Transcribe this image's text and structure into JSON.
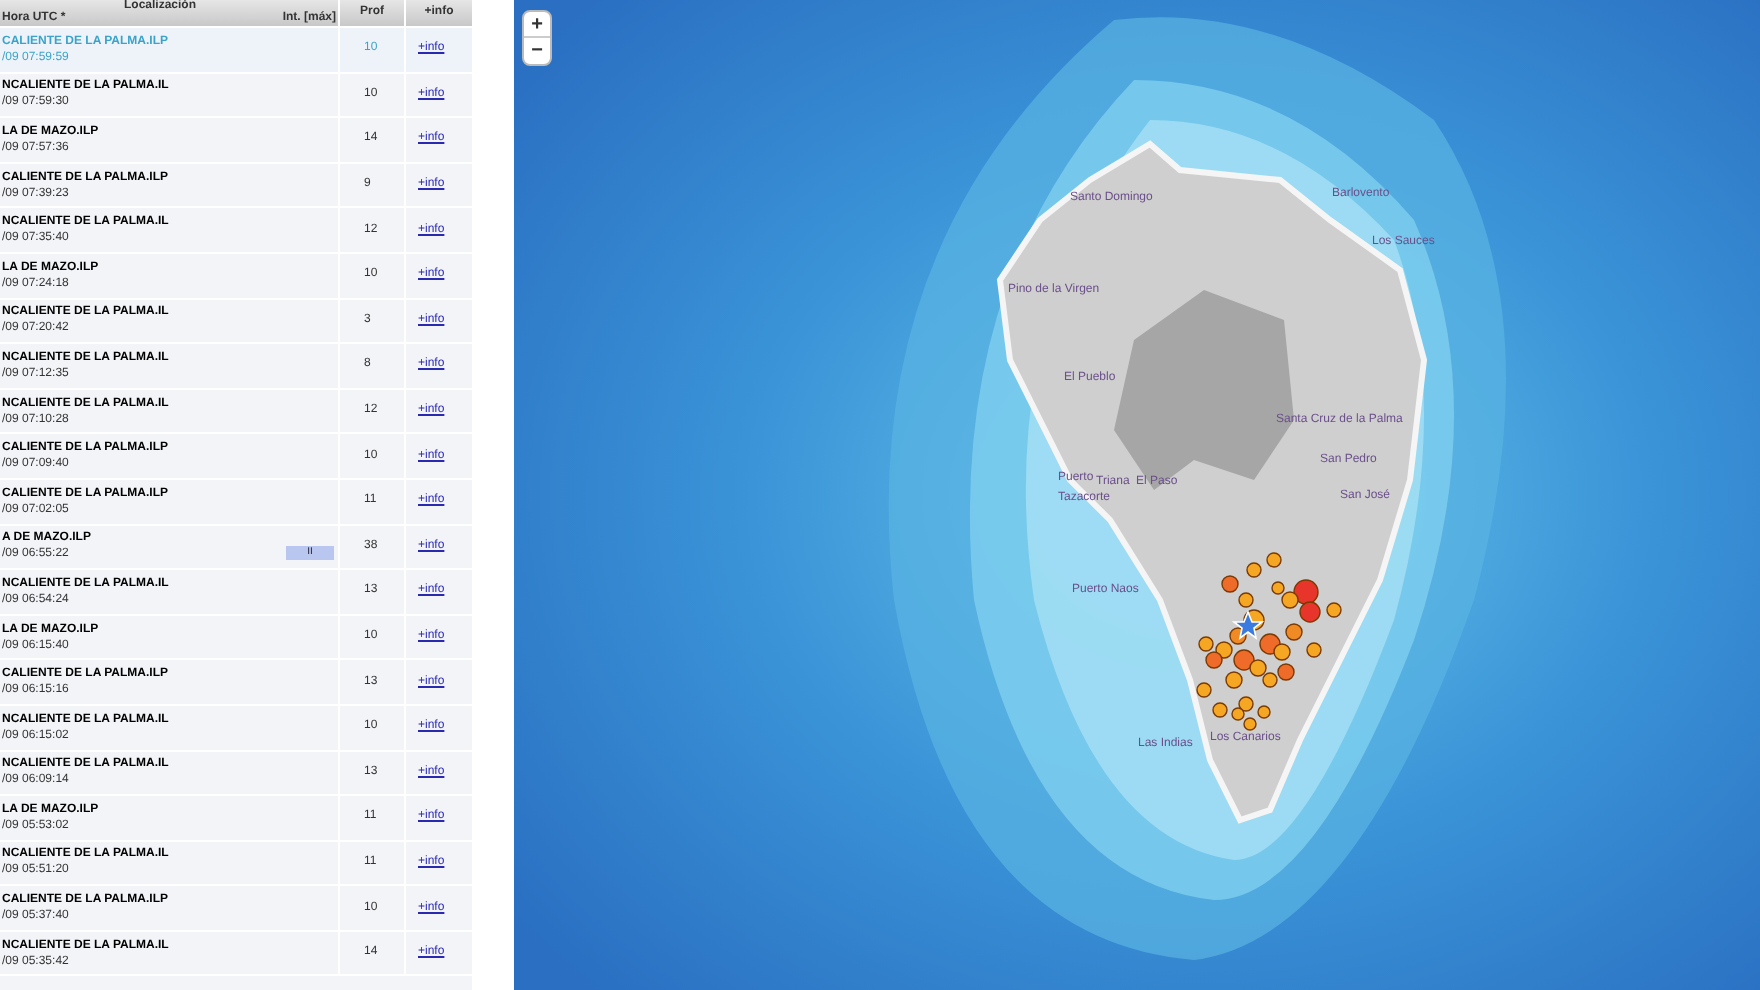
{
  "table": {
    "header": {
      "group": "Localización",
      "time": "Hora UTC *",
      "intensity": "Int. [máx]",
      "depth": "Prof",
      "info": "+info"
    },
    "rows": [
      {
        "location": "CALIENTE DE LA PALMA.ILP",
        "time": "/09 07:59:59",
        "depth": "10",
        "link": "+info",
        "selected": true
      },
      {
        "location": "NCALIENTE DE LA PALMA.IL",
        "time": "/09 07:59:30",
        "depth": "10",
        "link": "+info",
        "selected": false
      },
      {
        "location": "LA DE MAZO.ILP",
        "time": "/09 07:57:36",
        "depth": "14",
        "link": "+info",
        "selected": false
      },
      {
        "location": "CALIENTE DE LA PALMA.ILP",
        "time": "/09 07:39:23",
        "depth": "9",
        "link": "+info",
        "selected": false
      },
      {
        "location": "NCALIENTE DE LA PALMA.IL",
        "time": "/09 07:35:40",
        "depth": "12",
        "link": "+info",
        "selected": false
      },
      {
        "location": "LA DE MAZO.ILP",
        "time": "/09 07:24:18",
        "depth": "10",
        "link": "+info",
        "selected": false
      },
      {
        "location": "NCALIENTE DE LA PALMA.IL",
        "time": "/09 07:20:42",
        "depth": "3",
        "link": "+info",
        "selected": false
      },
      {
        "location": "NCALIENTE DE LA PALMA.IL",
        "time": "/09 07:12:35",
        "depth": "8",
        "link": "+info",
        "selected": false
      },
      {
        "location": "NCALIENTE DE LA PALMA.IL",
        "time": "/09 07:10:28",
        "depth": "12",
        "link": "+info",
        "selected": false
      },
      {
        "location": "CALIENTE DE LA PALMA.ILP",
        "time": "/09 07:09:40",
        "depth": "10",
        "link": "+info",
        "selected": false
      },
      {
        "location": "CALIENTE DE LA PALMA.ILP",
        "time": "/09 07:02:05",
        "depth": "11",
        "link": "+info",
        "selected": false
      },
      {
        "location": "A DE MAZO.ILP",
        "time": "/09 06:55:22",
        "intensity": "II",
        "depth": "38",
        "link": "+info",
        "selected": false
      },
      {
        "location": "NCALIENTE DE LA PALMA.IL",
        "time": "/09 06:54:24",
        "depth": "13",
        "link": "+info",
        "selected": false
      },
      {
        "location": "LA DE MAZO.ILP",
        "time": "/09 06:15:40",
        "depth": "10",
        "link": "+info",
        "selected": false
      },
      {
        "location": "CALIENTE DE LA PALMA.ILP",
        "time": "/09 06:15:16",
        "depth": "13",
        "link": "+info",
        "selected": false
      },
      {
        "location": "NCALIENTE DE LA PALMA.IL",
        "time": "/09 06:15:02",
        "depth": "10",
        "link": "+info",
        "selected": false
      },
      {
        "location": "NCALIENTE DE LA PALMA.IL",
        "time": "/09 06:09:14",
        "depth": "13",
        "link": "+info",
        "selected": false
      },
      {
        "location": "LA DE MAZO.ILP",
        "time": "/09 05:53:02",
        "depth": "11",
        "link": "+info",
        "selected": false
      },
      {
        "location": "NCALIENTE DE LA PALMA.IL",
        "time": "/09 05:51:20",
        "depth": "11",
        "link": "+info",
        "selected": false
      },
      {
        "location": "CALIENTE DE LA PALMA.ILP",
        "time": "/09 05:37:40",
        "depth": "10",
        "link": "+info",
        "selected": false
      },
      {
        "location": "NCALIENTE DE LA PALMA.IL",
        "time": "/09 05:35:42",
        "depth": "14",
        "link": "+info",
        "selected": false
      }
    ]
  },
  "map": {
    "zoom_in": "+",
    "zoom_out": "−",
    "places": [
      "Santo Domingo",
      "Barlovento",
      "Los Sauces",
      "Pino de la Virgen",
      "El Pueblo",
      "Santa Cruz de la Palma",
      "San Pedro",
      "San José",
      "Puerto",
      "Triana",
      "El Paso",
      "Tazacorte",
      "Puerto Naos",
      "Las Indias",
      "Los Canarios"
    ]
  }
}
